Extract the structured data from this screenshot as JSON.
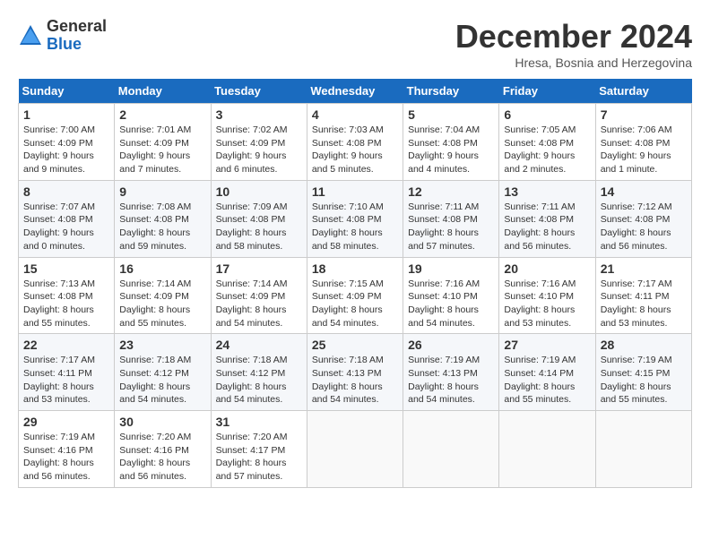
{
  "header": {
    "logo_general": "General",
    "logo_blue": "Blue",
    "month_title": "December 2024",
    "location": "Hresa, Bosnia and Herzegovina"
  },
  "weekdays": [
    "Sunday",
    "Monday",
    "Tuesday",
    "Wednesday",
    "Thursday",
    "Friday",
    "Saturday"
  ],
  "weeks": [
    [
      {
        "day": "1",
        "sunrise": "7:00 AM",
        "sunset": "4:09 PM",
        "daylight": "9 hours and 9 minutes."
      },
      {
        "day": "2",
        "sunrise": "7:01 AM",
        "sunset": "4:09 PM",
        "daylight": "9 hours and 7 minutes."
      },
      {
        "day": "3",
        "sunrise": "7:02 AM",
        "sunset": "4:09 PM",
        "daylight": "9 hours and 6 minutes."
      },
      {
        "day": "4",
        "sunrise": "7:03 AM",
        "sunset": "4:08 PM",
        "daylight": "9 hours and 5 minutes."
      },
      {
        "day": "5",
        "sunrise": "7:04 AM",
        "sunset": "4:08 PM",
        "daylight": "9 hours and 4 minutes."
      },
      {
        "day": "6",
        "sunrise": "7:05 AM",
        "sunset": "4:08 PM",
        "daylight": "9 hours and 2 minutes."
      },
      {
        "day": "7",
        "sunrise": "7:06 AM",
        "sunset": "4:08 PM",
        "daylight": "9 hours and 1 minute."
      }
    ],
    [
      {
        "day": "8",
        "sunrise": "7:07 AM",
        "sunset": "4:08 PM",
        "daylight": "9 hours and 0 minutes."
      },
      {
        "day": "9",
        "sunrise": "7:08 AM",
        "sunset": "4:08 PM",
        "daylight": "8 hours and 59 minutes."
      },
      {
        "day": "10",
        "sunrise": "7:09 AM",
        "sunset": "4:08 PM",
        "daylight": "8 hours and 58 minutes."
      },
      {
        "day": "11",
        "sunrise": "7:10 AM",
        "sunset": "4:08 PM",
        "daylight": "8 hours and 58 minutes."
      },
      {
        "day": "12",
        "sunrise": "7:11 AM",
        "sunset": "4:08 PM",
        "daylight": "8 hours and 57 minutes."
      },
      {
        "day": "13",
        "sunrise": "7:11 AM",
        "sunset": "4:08 PM",
        "daylight": "8 hours and 56 minutes."
      },
      {
        "day": "14",
        "sunrise": "7:12 AM",
        "sunset": "4:08 PM",
        "daylight": "8 hours and 56 minutes."
      }
    ],
    [
      {
        "day": "15",
        "sunrise": "7:13 AM",
        "sunset": "4:08 PM",
        "daylight": "8 hours and 55 minutes."
      },
      {
        "day": "16",
        "sunrise": "7:14 AM",
        "sunset": "4:09 PM",
        "daylight": "8 hours and 55 minutes."
      },
      {
        "day": "17",
        "sunrise": "7:14 AM",
        "sunset": "4:09 PM",
        "daylight": "8 hours and 54 minutes."
      },
      {
        "day": "18",
        "sunrise": "7:15 AM",
        "sunset": "4:09 PM",
        "daylight": "8 hours and 54 minutes."
      },
      {
        "day": "19",
        "sunrise": "7:16 AM",
        "sunset": "4:10 PM",
        "daylight": "8 hours and 54 minutes."
      },
      {
        "day": "20",
        "sunrise": "7:16 AM",
        "sunset": "4:10 PM",
        "daylight": "8 hours and 53 minutes."
      },
      {
        "day": "21",
        "sunrise": "7:17 AM",
        "sunset": "4:11 PM",
        "daylight": "8 hours and 53 minutes."
      }
    ],
    [
      {
        "day": "22",
        "sunrise": "7:17 AM",
        "sunset": "4:11 PM",
        "daylight": "8 hours and 53 minutes."
      },
      {
        "day": "23",
        "sunrise": "7:18 AM",
        "sunset": "4:12 PM",
        "daylight": "8 hours and 54 minutes."
      },
      {
        "day": "24",
        "sunrise": "7:18 AM",
        "sunset": "4:12 PM",
        "daylight": "8 hours and 54 minutes."
      },
      {
        "day": "25",
        "sunrise": "7:18 AM",
        "sunset": "4:13 PM",
        "daylight": "8 hours and 54 minutes."
      },
      {
        "day": "26",
        "sunrise": "7:19 AM",
        "sunset": "4:13 PM",
        "daylight": "8 hours and 54 minutes."
      },
      {
        "day": "27",
        "sunrise": "7:19 AM",
        "sunset": "4:14 PM",
        "daylight": "8 hours and 55 minutes."
      },
      {
        "day": "28",
        "sunrise": "7:19 AM",
        "sunset": "4:15 PM",
        "daylight": "8 hours and 55 minutes."
      }
    ],
    [
      {
        "day": "29",
        "sunrise": "7:19 AM",
        "sunset": "4:16 PM",
        "daylight": "8 hours and 56 minutes."
      },
      {
        "day": "30",
        "sunrise": "7:20 AM",
        "sunset": "4:16 PM",
        "daylight": "8 hours and 56 minutes."
      },
      {
        "day": "31",
        "sunrise": "7:20 AM",
        "sunset": "4:17 PM",
        "daylight": "8 hours and 57 minutes."
      },
      null,
      null,
      null,
      null
    ]
  ]
}
